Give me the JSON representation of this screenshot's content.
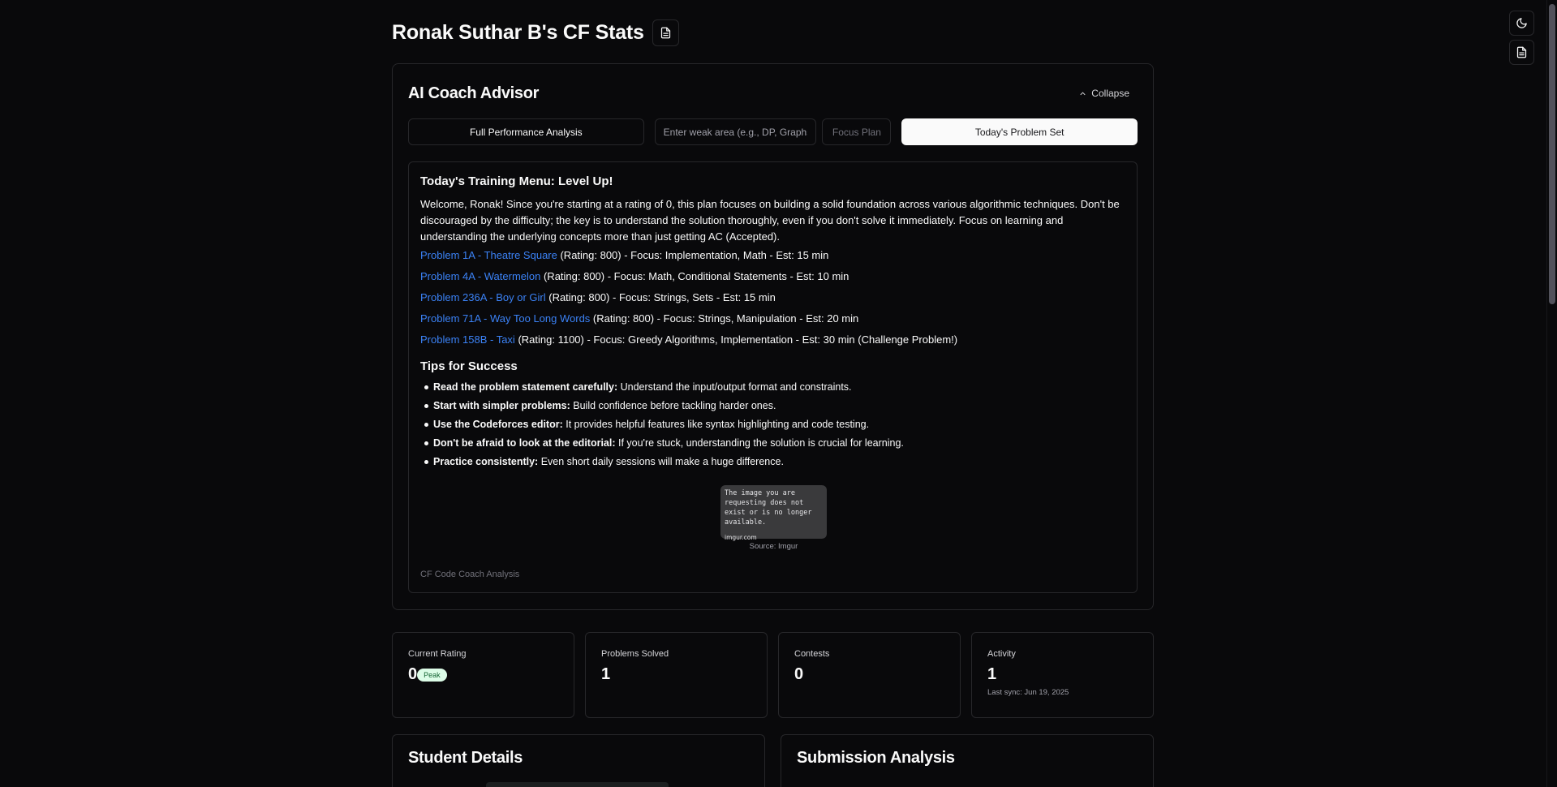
{
  "header": {
    "title": "Ronak Suthar B's CF Stats",
    "doc_icon": "file-text-icon"
  },
  "top_right": {
    "theme_icon": "moon-icon",
    "doc_icon": "file-text-icon"
  },
  "coach": {
    "title": "AI Coach Advisor",
    "collapse_label": "Collapse",
    "full_analysis_label": "Full Performance Analysis",
    "weak_area_placeholder": "Enter weak area (e.g., DP, Graphs)",
    "focus_plan_label": "Focus Plan",
    "problem_set_label": "Today's Problem Set",
    "output": {
      "heading": "Today's Training Menu: Level Up!",
      "intro": "Welcome, Ronak! Since you're starting at a rating of 0, this plan focuses on building a solid foundation across various algorithmic techniques. Don't be discouraged by the difficulty; the key is to understand the solution thoroughly, even if you don't solve it immediately. Focus on learning and understanding the underlying concepts more than just getting AC (Accepted).",
      "problems": [
        {
          "link": "Problem 1A - Theatre Square",
          "desc": " (Rating: 800) - Focus: Implementation, Math - Est: 15 min"
        },
        {
          "link": "Problem 4A - Watermelon",
          "desc": " (Rating: 800) - Focus: Math, Conditional Statements - Est: 10 min"
        },
        {
          "link": "Problem 236A - Boy or Girl",
          "desc": " (Rating: 800) - Focus: Strings, Sets - Est: 15 min"
        },
        {
          "link": "Problem 71A - Way Too Long Words",
          "desc": " (Rating: 800) - Focus: Strings, Manipulation - Est: 20 min"
        },
        {
          "link": "Problem 158B - Taxi",
          "desc": " (Rating: 1100) - Focus: Greedy Algorithms, Implementation - Est: 30 min (Challenge Problem!)"
        }
      ],
      "tips_heading": "Tips for Success",
      "tips": [
        {
          "bold": "Read the problem statement carefully:",
          "text": " Understand the input/output format and constraints."
        },
        {
          "bold": "Start with simpler problems:",
          "text": " Build confidence before tackling harder ones."
        },
        {
          "bold": "Use the Codeforces editor:",
          "text": " It provides helpful features like syntax highlighting and code testing."
        },
        {
          "bold": "Don't be afraid to look at the editorial:",
          "text": " If you're stuck, understanding the solution is crucial for learning."
        },
        {
          "bold": "Practice consistently:",
          "text": " Even short daily sessions will make a huge difference."
        }
      ],
      "image_message": "The image you are requesting does not exist or is no longer available.",
      "image_domain": "imgur.com",
      "image_caption": "Source: Imgur",
      "footer": "CF Code Coach Analysis"
    }
  },
  "stats": {
    "rating_label": "Current Rating",
    "rating_value": "0",
    "peak_badge": "Peak",
    "solved_label": "Problems Solved",
    "solved_value": "1",
    "contests_label": "Contests",
    "contests_value": "0",
    "activity_label": "Activity",
    "activity_value": "1",
    "last_sync": "Last sync: Jun 19, 2025"
  },
  "panels": {
    "student_details": "Student Details",
    "submission_analysis": "Submission Analysis"
  },
  "colors": {
    "background": "#09090b",
    "border": "#27272a",
    "link": "#3b82f6",
    "peak_badge_bg": "#dcfce7"
  }
}
